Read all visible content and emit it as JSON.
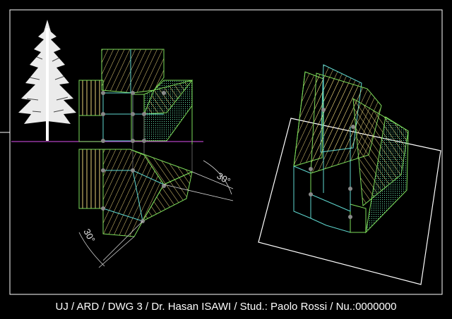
{
  "dimensions": {
    "angle_top": "30°",
    "angle_bottom": "30°"
  },
  "title_block": {
    "text": "UJ / ARD / DWG 3  / Dr. Hasan ISAWI / Stud.: Paolo Rossi / Nu.:0000000"
  },
  "colors": {
    "background": "#000000",
    "frame": "#ffffff",
    "green_edges": "#7ddc5a",
    "cyan_edges": "#5fd8d0",
    "yellow_hatch": "#e8d27a",
    "ground_line": "#b040c0",
    "points": "#8a8a8a",
    "dimension": "#d8d8d8"
  }
}
